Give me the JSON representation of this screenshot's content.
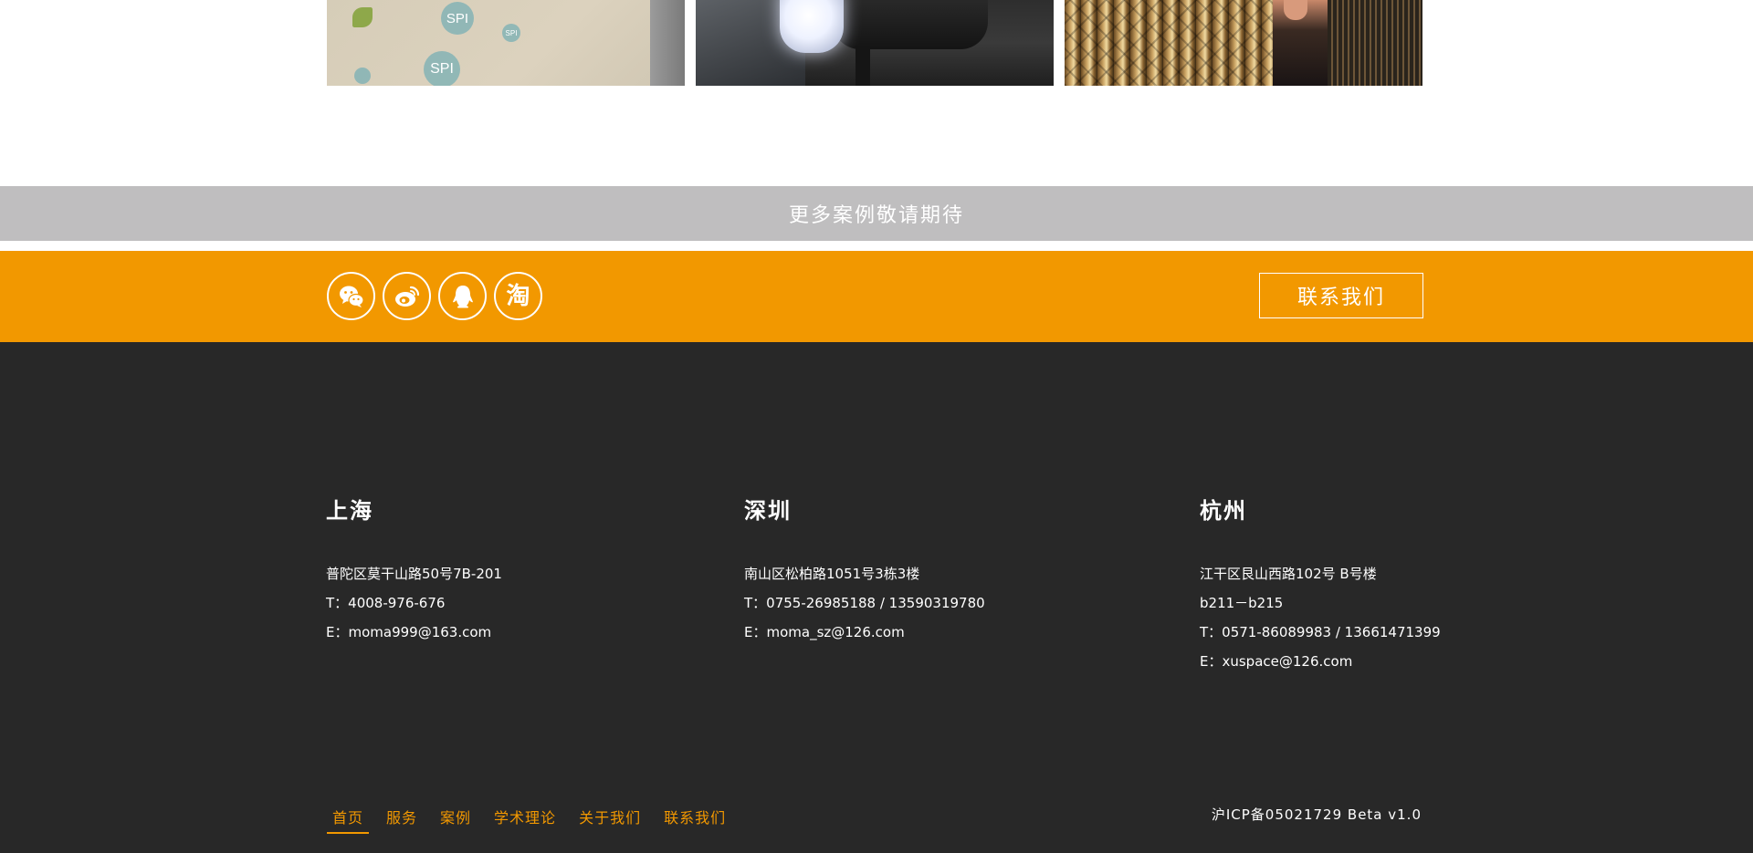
{
  "gallery": {
    "tiles": [
      {
        "bubble_labels": [
          "SPI",
          "SPI",
          "SPI"
        ]
      },
      {},
      {}
    ]
  },
  "banner": {
    "text": "更多案例敬请期待"
  },
  "social": {
    "icons": [
      "wechat-icon",
      "weibo-icon",
      "qq-icon",
      "taobao-icon"
    ],
    "taobao_glyph": "淘",
    "contact_label": "联系我们",
    "band_color": "#f29800"
  },
  "offices": [
    {
      "city": "上海",
      "lines": [
        "普陀区莫干山路50号7B-201",
        "T：4008-976-676",
        "E：moma999@163.com"
      ]
    },
    {
      "city": "深圳",
      "lines": [
        "南山区松柏路1051号3栋3楼",
        "T：0755-26985188 / 13590319780",
        "E：moma_sz@126.com"
      ]
    },
    {
      "city": "杭州",
      "lines": [
        "江干区艮山西路102号 B号楼",
        "b211－b215",
        "T：0571-86089983 / 13661471399",
        "E：xuspace@126.com"
      ]
    }
  ],
  "footer_nav": [
    {
      "label": "首页",
      "active": true
    },
    {
      "label": "服务"
    },
    {
      "label": "案例"
    },
    {
      "label": "学术理论"
    },
    {
      "label": "关于我们"
    },
    {
      "label": "联系我们"
    }
  ],
  "icp": "沪ICP备05021729 Beta v1.0",
  "colors": {
    "accent": "#f29800",
    "footer_bg": "#282828",
    "banner_bg": "#bfbebf"
  }
}
